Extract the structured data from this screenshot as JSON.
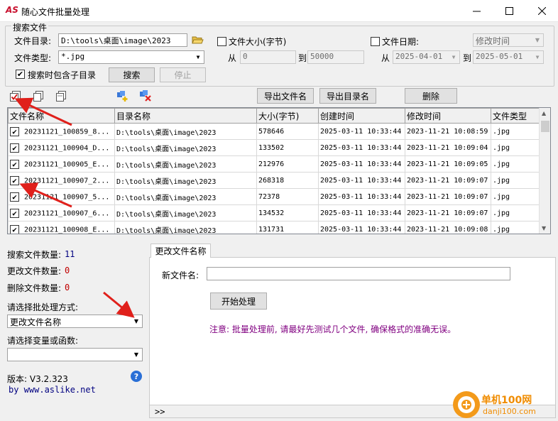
{
  "window": {
    "logo": "AS",
    "title": "随心文件批量处理",
    "controls": [
      "minimize",
      "maximize",
      "close"
    ]
  },
  "search": {
    "group_title": "搜索文件",
    "dir_label": "文件目录:",
    "dir_value": "D:\\tools\\桌面\\image\\2023",
    "type_label": "文件类型:",
    "type_value": "*.jpg",
    "include_sub_label": "搜索时包含子目录",
    "include_sub_checked": true,
    "size_label": "文件大小(字节)",
    "size_from_label": "从",
    "size_from": "0",
    "size_to_label": "到",
    "size_to": "50000",
    "date_label": "文件日期:",
    "date_mode": "修改时间",
    "date_from_label": "从",
    "date_from": "2025-04-01",
    "date_to_label": "到",
    "date_to": "2025-05-01",
    "search_btn": "搜索",
    "stop_btn": "停止"
  },
  "toolbar": {
    "export_names_btn": "导出文件名",
    "export_dirs_btn": "导出目录名",
    "delete_btn": "删除",
    "icons": [
      "check-all-icon",
      "copy-icon",
      "copy-alt-icon",
      "add-files-icon",
      "remove-files-icon"
    ]
  },
  "grid": {
    "headers": [
      "文件名称",
      "目录名称",
      "大小(字节)",
      "创建时间",
      "修改时间",
      "文件类型"
    ],
    "rows": [
      {
        "checked": true,
        "name": "20231121_100859_8...",
        "dir": "D:\\tools\\桌面\\image\\2023",
        "size": "578646",
        "created": "2025-03-11 10:33:44",
        "modified": "2023-11-21 10:08:59",
        "type": ".jpg"
      },
      {
        "checked": true,
        "name": "20231121_100904_D...",
        "dir": "D:\\tools\\桌面\\image\\2023",
        "size": "133502",
        "created": "2025-03-11 10:33:44",
        "modified": "2023-11-21 10:09:04",
        "type": ".jpg"
      },
      {
        "checked": true,
        "name": "20231121_100905_E...",
        "dir": "D:\\tools\\桌面\\image\\2023",
        "size": "212976",
        "created": "2025-03-11 10:33:44",
        "modified": "2023-11-21 10:09:05",
        "type": ".jpg"
      },
      {
        "checked": true,
        "name": "20231121_100907_2...",
        "dir": "D:\\tools\\桌面\\image\\2023",
        "size": "268318",
        "created": "2025-03-11 10:33:44",
        "modified": "2023-11-21 10:09:07",
        "type": ".jpg"
      },
      {
        "checked": true,
        "name": "20231121_100907_5...",
        "dir": "D:\\tools\\桌面\\image\\2023",
        "size": "72378",
        "created": "2025-03-11 10:33:44",
        "modified": "2023-11-21 10:09:07",
        "type": ".jpg"
      },
      {
        "checked": true,
        "name": "20231121_100907_6...",
        "dir": "D:\\tools\\桌面\\image\\2023",
        "size": "134532",
        "created": "2025-03-11 10:33:44",
        "modified": "2023-11-21 10:09:07",
        "type": ".jpg"
      },
      {
        "checked": true,
        "name": "20231121_100908_E...",
        "dir": "D:\\tools\\桌面\\image\\2023",
        "size": "131731",
        "created": "2025-03-11 10:33:44",
        "modified": "2023-11-21 10:09:08",
        "type": ".jpg"
      }
    ]
  },
  "stats": {
    "found_label": "搜索文件数量:",
    "found_value": "11",
    "renamed_label": "更改文件数量:",
    "renamed_value": "0",
    "deleted_label": "删除文件数量:",
    "deleted_value": "0"
  },
  "mode": {
    "method_label": "请选择批处理方式:",
    "method_value": "更改文件名称",
    "var_label": "请选择变量或函数:",
    "var_value": ""
  },
  "about": {
    "version": "版本: V3.2.323",
    "site": "by www.aslike.net"
  },
  "tab": {
    "label": "更改文件名称",
    "new_name_label": "新文件名:",
    "new_name_value": "",
    "start_btn": "开始处理",
    "note": "注意: 批量处理前, 请最好先测试几个文件, 确保格式的准确无误。",
    "expand": ">>"
  },
  "watermark": {
    "line1": "单机100网",
    "line2": "danji100.com"
  },
  "colors": {
    "accent_blue": "#000080",
    "value_red": "#c00000",
    "note_purple": "#800080",
    "logo_red": "#c8102e",
    "annotation_red": "#e0201b"
  }
}
